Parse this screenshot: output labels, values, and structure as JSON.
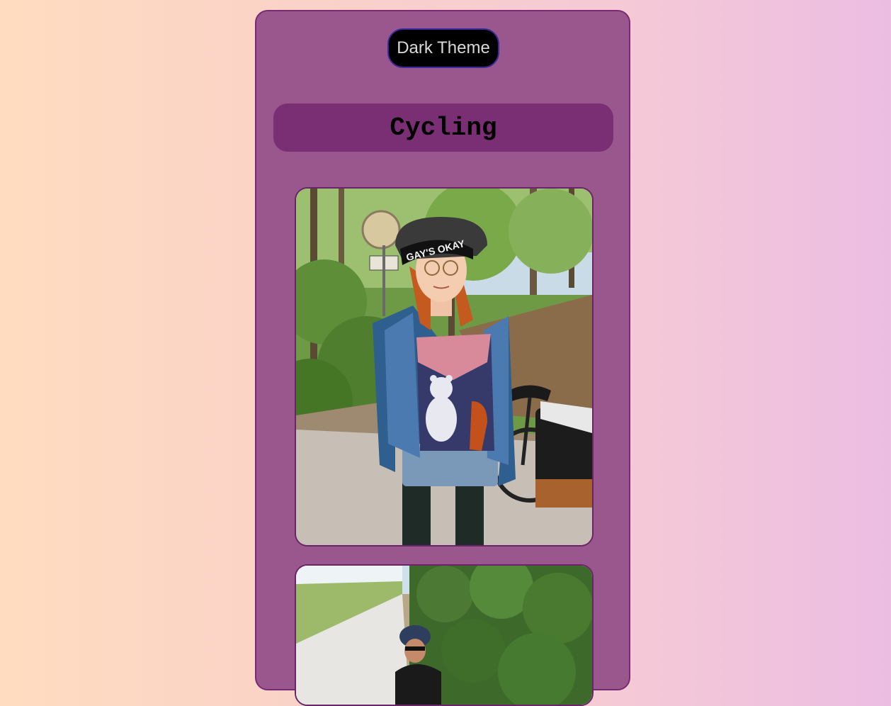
{
  "theme_toggle": {
    "label": "Dark Theme"
  },
  "page": {
    "title": "Cycling"
  },
  "photo_1": {
    "helmet_text": "GAY'S OKAY"
  },
  "colors": {
    "background_left": "#ffdcc0",
    "background_right": "#ecbde2",
    "panel": "#9a578d",
    "title_bar": "#7a2e74",
    "button": "#000000"
  }
}
